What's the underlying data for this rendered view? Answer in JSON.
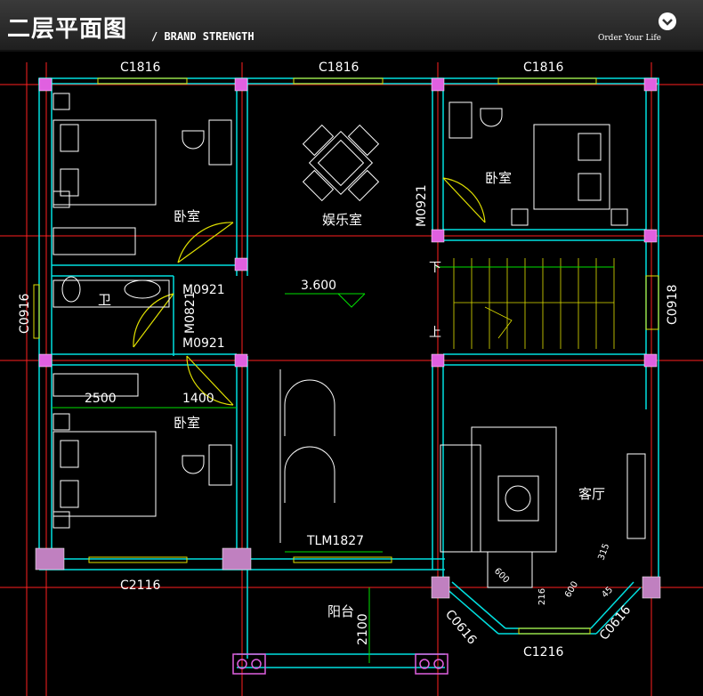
{
  "header": {
    "title": "二层平面图",
    "subtitle": "/ BRAND STRENGTH",
    "slogan": "Order Your Life",
    "logo_icon": "chevron-down-circle-icon"
  },
  "rooms": {
    "bedroom_nw": "卧室",
    "entertainment": "娱乐室",
    "bedroom_ne": "卧室",
    "bathroom": "卫",
    "bedroom_sw": "卧室",
    "living": "客厅",
    "balcony": "阳台"
  },
  "labels": {
    "win_top_left": "C1816",
    "win_top_mid": "C1816",
    "win_top_right": "C1816",
    "door_ne": "M0921",
    "door_bath_1": "M0921",
    "door_bath_2": "M0821",
    "door_bath_3": "M0921",
    "win_left": "C0916",
    "win_right": "C0918",
    "elevation": "3.600",
    "stair_down": "下",
    "stair_up": "上",
    "dim_2500": "2500",
    "dim_1400": "1400",
    "door_balcony": "TLM1827",
    "win_bottom_left": "C2116",
    "dim_2100": "2100",
    "bay_left": "C0616",
    "bay_mid": "C1216",
    "bay_right": "C0616",
    "dim_600": "600",
    "dim_216": "216",
    "dim_600b": "600",
    "dim_315": "315",
    "dim_45": "45"
  },
  "colors": {
    "wall": "#00e0e0",
    "grid": "#ff2020",
    "column": "#e060e0",
    "furniture": "#ffffff",
    "window": "#e0e000",
    "door": "#e0e000",
    "dimension": "#00e000",
    "text": "#ffffff"
  }
}
